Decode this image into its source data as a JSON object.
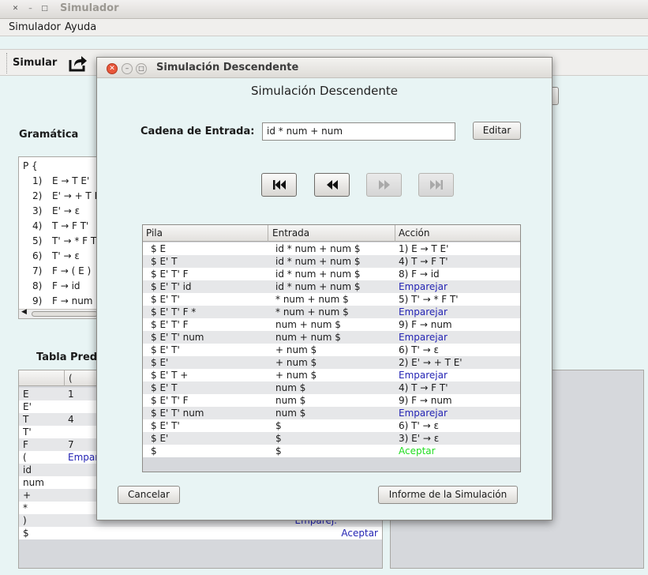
{
  "window": {
    "title": "Simulador"
  },
  "menu": [
    "Simulador",
    "Ayuda"
  ],
  "toolbar": {
    "simular_label": "Simular"
  },
  "grammar": {
    "label": "Gramática",
    "header": "P {",
    "lines": [
      {
        "n": "1)",
        "rule": "E → T E'"
      },
      {
        "n": "2)",
        "rule": "E' → + T E'"
      },
      {
        "n": "3)",
        "rule": "E' → ε"
      },
      {
        "n": "4)",
        "rule": "T → F T'"
      },
      {
        "n": "5)",
        "rule": "T' → * F T'"
      },
      {
        "n": "6)",
        "rule": "T' → ε"
      },
      {
        "n": "7)",
        "rule": "F → ( E )"
      },
      {
        "n": "8)",
        "rule": "F → id"
      },
      {
        "n": "9)",
        "rule": "F → num"
      }
    ]
  },
  "predictive_table": {
    "label": "Tabla Pred",
    "header_col": "(",
    "rows": [
      {
        "sym": "E",
        "val": "1",
        "right": ""
      },
      {
        "sym": "E'",
        "val": "",
        "right": ""
      },
      {
        "sym": "T",
        "val": "4",
        "right": ""
      },
      {
        "sym": "T'",
        "val": "",
        "right": ""
      },
      {
        "sym": "F",
        "val": "7",
        "right": ""
      },
      {
        "sym": "(",
        "val": "Empar",
        "right": ""
      },
      {
        "sym": "id",
        "val": "",
        "right": ""
      },
      {
        "sym": "num",
        "val": "",
        "right": ""
      },
      {
        "sym": "+",
        "val": "",
        "right": ""
      },
      {
        "sym": "*",
        "val": "",
        "right": ""
      },
      {
        "sym": ")",
        "val": "",
        "right": "Emparej."
      },
      {
        "sym": "$",
        "val": "",
        "right": "Aceptar"
      }
    ]
  },
  "dialog": {
    "title": "Simulación Descendente",
    "heading": "Simulación Descendente",
    "input_label": "Cadena de Entrada:",
    "input_value": "id * num + num",
    "edit_button": "Editar",
    "columns": [
      "Pila",
      "Entrada",
      "Acción"
    ],
    "rows": [
      {
        "pila": "$ E",
        "entrada": "id * num + num $",
        "accion": "1) E → T E'",
        "type": "rule"
      },
      {
        "pila": "$ E' T",
        "entrada": "id * num + num $",
        "accion": "4) T → F T'",
        "type": "rule"
      },
      {
        "pila": "$ E' T' F",
        "entrada": "id * num + num $",
        "accion": "8) F → id",
        "type": "rule"
      },
      {
        "pila": "$ E' T' id",
        "entrada": "id * num + num $",
        "accion": "Emparejar",
        "type": "match"
      },
      {
        "pila": "$ E' T'",
        "entrada": "* num + num $",
        "accion": "5) T' → * F T'",
        "type": "rule"
      },
      {
        "pila": "$ E' T' F *",
        "entrada": "* num + num $",
        "accion": "Emparejar",
        "type": "match"
      },
      {
        "pila": "$ E' T' F",
        "entrada": "num + num $",
        "accion": "9) F → num",
        "type": "rule"
      },
      {
        "pila": "$ E' T' num",
        "entrada": "num + num $",
        "accion": "Emparejar",
        "type": "match"
      },
      {
        "pila": "$ E' T'",
        "entrada": "+ num $",
        "accion": "6) T' → ε",
        "type": "rule"
      },
      {
        "pila": "$ E'",
        "entrada": "+ num $",
        "accion": "2) E' → + T E'",
        "type": "rule"
      },
      {
        "pila": "$ E' T +",
        "entrada": "+ num $",
        "accion": "Emparejar",
        "type": "match"
      },
      {
        "pila": "$ E' T",
        "entrada": "num $",
        "accion": "4) T → F T'",
        "type": "rule"
      },
      {
        "pila": "$ E' T' F",
        "entrada": "num $",
        "accion": "9) F → num",
        "type": "rule"
      },
      {
        "pila": "$ E' T' num",
        "entrada": "num $",
        "accion": "Emparejar",
        "type": "match"
      },
      {
        "pila": "$ E' T'",
        "entrada": "$",
        "accion": "6) T' → ε",
        "type": "rule"
      },
      {
        "pila": "$ E'",
        "entrada": "$",
        "accion": "3) E' → ε",
        "type": "rule"
      },
      {
        "pila": "$",
        "entrada": "$",
        "accion": "Aceptar",
        "type": "accept"
      }
    ],
    "cancel_button": "Cancelar",
    "report_button": "Informe de la Simulación"
  },
  "colors": {
    "match": "#2424b4",
    "accept": "#22dd22",
    "close_button": "#e8563a"
  }
}
